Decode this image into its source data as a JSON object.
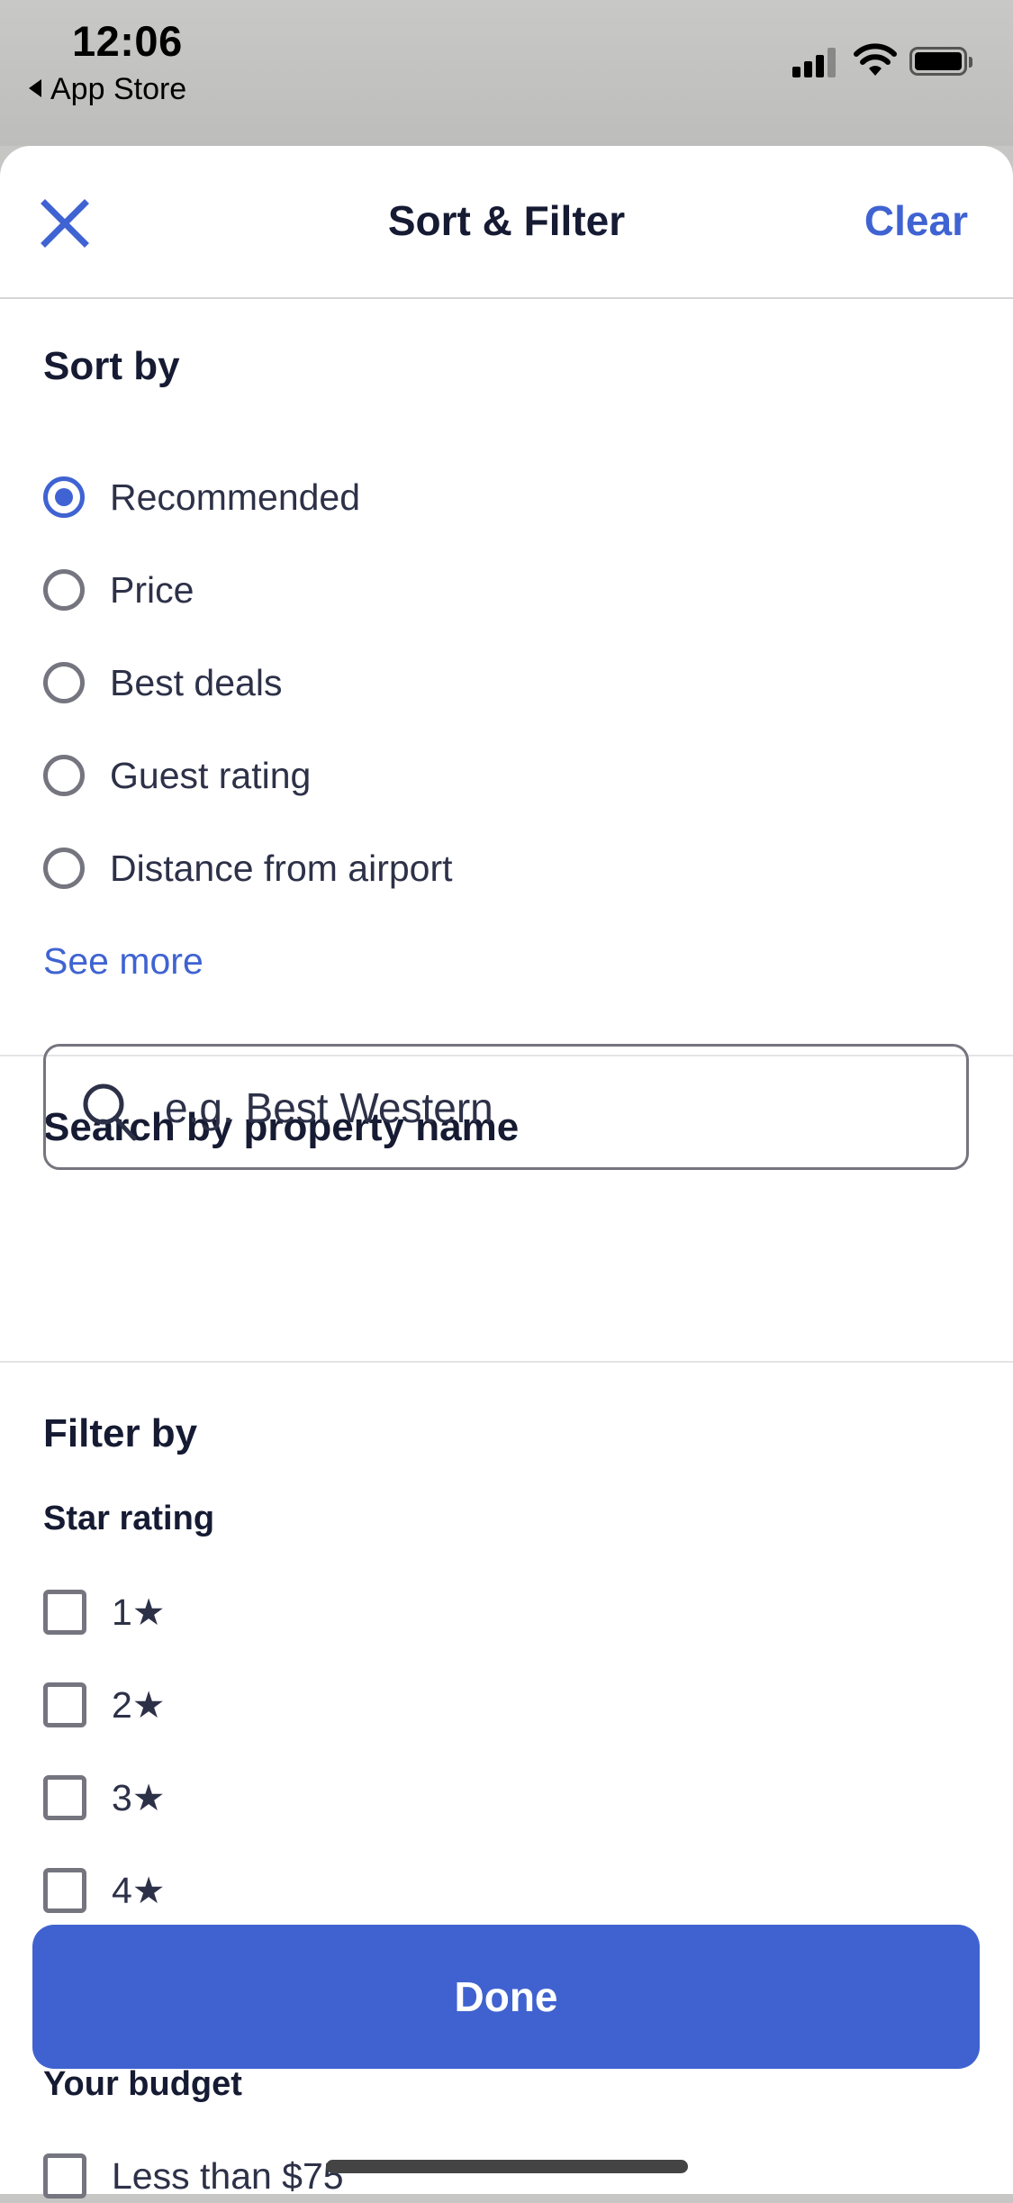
{
  "status_bar": {
    "time": "12:06",
    "back_label": "App Store"
  },
  "header": {
    "title": "Sort & Filter",
    "clear_label": "Clear"
  },
  "sort": {
    "heading": "Sort by",
    "options": [
      {
        "label": "Recommended",
        "selected": true
      },
      {
        "label": "Price",
        "selected": false
      },
      {
        "label": "Best deals",
        "selected": false
      },
      {
        "label": "Guest rating",
        "selected": false
      },
      {
        "label": "Distance from airport",
        "selected": false
      }
    ],
    "see_more_label": "See more"
  },
  "search": {
    "heading": "Search by property name",
    "placeholder": "e.g. Best Western",
    "value": ""
  },
  "filter": {
    "heading": "Filter by",
    "star_rating": {
      "heading": "Star rating",
      "options": [
        {
          "label": "1★",
          "checked": false
        },
        {
          "label": "2★",
          "checked": false
        },
        {
          "label": "3★",
          "checked": false
        },
        {
          "label": "4★",
          "checked": false
        }
      ]
    },
    "budget": {
      "heading": "Your budget",
      "options": [
        {
          "label": "Less than $75",
          "checked": false
        }
      ]
    }
  },
  "footer": {
    "done_label": "Done"
  },
  "colors": {
    "accent": "#3f63d2",
    "button": "#4062d0",
    "text": "#161b33",
    "control_border": "#757580"
  }
}
